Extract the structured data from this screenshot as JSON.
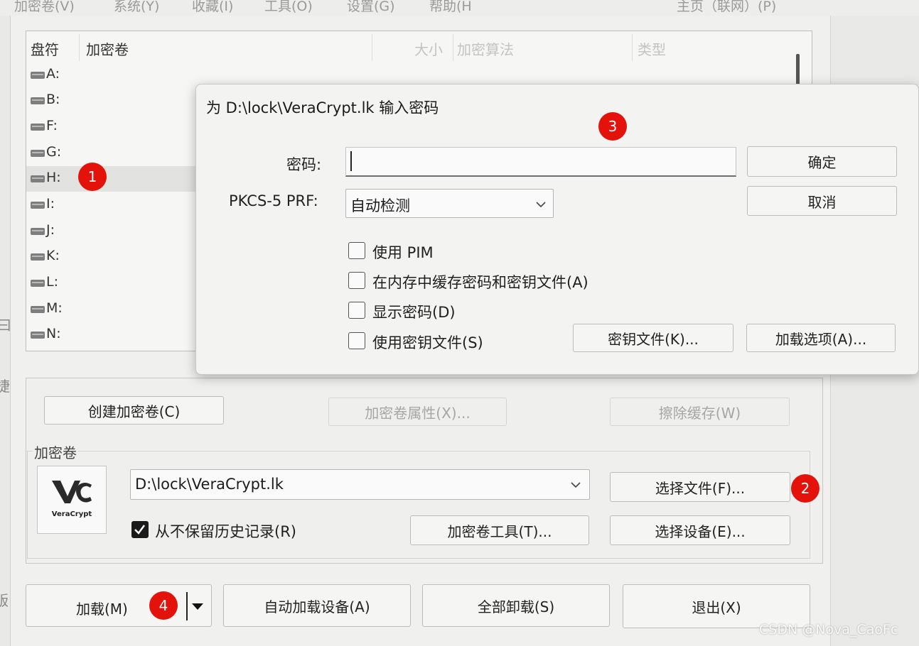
{
  "menu": {
    "items": [
      "加密卷(V)",
      "系统(Y)",
      "收藏(I)",
      "工具(O)",
      "设置(G)",
      "帮助(H"
    ],
    "right_link": "主页（联网）(P)"
  },
  "drive_list": {
    "columns": {
      "drive": "盘符",
      "volume": "加密卷",
      "size": "大小",
      "algorithm": "加密算法",
      "type": "类型"
    },
    "drives": [
      "A:",
      "B:",
      "F:",
      "G:",
      "H:",
      "I:",
      "J:",
      "K:",
      "L:",
      "M:",
      "N:"
    ],
    "selected": "H:"
  },
  "edge_fragments": [
    "曰",
    "捷",
    "贩"
  ],
  "dialog": {
    "title": "为 D:\\lock\\VeraCrypt.lk 输入密码",
    "password_label": "密码:",
    "password_value": "",
    "prf_label": "PKCS-5 PRF:",
    "prf_value": "自动检测",
    "ok_label": "确定",
    "cancel_label": "取消",
    "use_pim_label": "使用 PIM",
    "cache_label": "在内存中缓存密码和密钥文件(A)",
    "show_password_label": "显示密码(D)",
    "use_keyfiles_label": "使用密钥文件(S)",
    "keyfiles_button": "密钥文件(K)...",
    "mount_options_button": "加载选项(A)..."
  },
  "actions": {
    "create_volume": "创建加密卷(C)",
    "volume_properties": "加密卷属性(X)...",
    "wipe_cache": "擦除缓存(W)"
  },
  "volume": {
    "group_label": "加密卷",
    "path": "D:\\lock\\VeraCrypt.lk",
    "logo_text": "VeraCrypt",
    "never_save_history_label": "从不保留历史记录(R)",
    "never_save_history_checked": true,
    "select_file": "选择文件(F)...",
    "volume_tools": "加密卷工具(T)...",
    "select_device": "选择设备(E)..."
  },
  "bottom": {
    "mount": "加载(M)",
    "auto_mount": "自动加载设备(A)",
    "dismount_all": "全部卸载(S)",
    "exit": "退出(X)"
  },
  "badges": [
    "1",
    "2",
    "3",
    "4"
  ],
  "watermark": "CSDN @Nova_CaoFc",
  "colors": {
    "badge": "#e3120b",
    "window": "#f0f0ee"
  }
}
